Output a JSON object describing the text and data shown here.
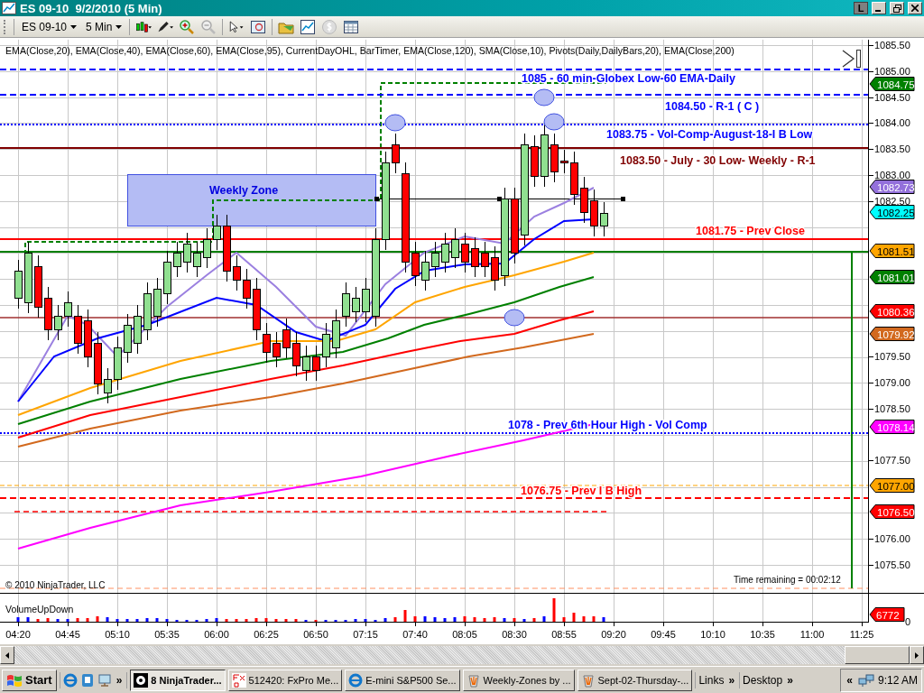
{
  "window": {
    "title": "ES 09-10  9/2/2010 (5 Min)",
    "buttons": [
      "L"
    ]
  },
  "toolbar": {
    "instrument": "ES 09-10",
    "interval": "5 Min"
  },
  "chart": {
    "indicators": "EMA(Close,20), EMA(Close,40), EMA(Close,60), EMA(Close,95), CurrentDayOHL, BarTimer, EMA(Close,120), SMA(Close,10), Pivots(Daily,DailyBars,20), EMA(Close,200)",
    "zone_label": "Weekly Zone",
    "levels": [
      {
        "text": "1085 - 60 min-Globex Low-60 EMA-Daily",
        "color": "#0000ff",
        "kind": "dashed"
      },
      {
        "text": "1084.50 - R-1 ( C )",
        "color": "#0000ff",
        "kind": "dashed"
      },
      {
        "text": "1083.75 - Vol-Comp-August-18-I B Low",
        "color": "#0000ff",
        "kind": "dotted"
      },
      {
        "text": "1083.50 - July - 30 Low- Weekly - R-1",
        "color": "#800000",
        "kind": "solid"
      },
      {
        "text": "1081.75 - Prev Close",
        "color": "#ff0000",
        "kind": "solid"
      },
      {
        "text": "1078 - Prev 6th Hour High - Vol Comp",
        "color": "#0000ff",
        "kind": "dotted"
      },
      {
        "text": "1076.75 - Prev I B High",
        "color": "#ff0000",
        "kind": "dashed"
      }
    ],
    "price_ticks": [
      "1085.50",
      "1085.00",
      "1084.50",
      "1084.00",
      "1083.50",
      "1083.00",
      "1082.50",
      "1079.50",
      "1079.00",
      "1078.50",
      "1077.50",
      "1076.00",
      "1075.50"
    ],
    "price_tags": [
      {
        "text": "1084.75",
        "color": "#008000"
      },
      {
        "text": "1082.73",
        "color": "#9370db"
      },
      {
        "text": "1082.25",
        "color": "#00ffff"
      },
      {
        "text": "1081.51",
        "color": "#ffa500"
      },
      {
        "text": "1081.01",
        "color": "#008000"
      },
      {
        "text": "1080.36",
        "color": "#ff0000"
      },
      {
        "text": "1079.92",
        "color": "#d2691e"
      },
      {
        "text": "1078.14",
        "color": "#ff00ff"
      },
      {
        "text": "1077.00",
        "color": "#ffa500"
      },
      {
        "text": "1076.50",
        "color": "#ff0000"
      }
    ],
    "copyright": "© 2010 NinjaTrader, LLC",
    "time_remaining": "Time remaining = 00:02:12"
  },
  "volume_panel": {
    "title": "VolumeUpDown",
    "tag": {
      "text": "6772",
      "color": "#ff0000"
    },
    "zero_label": "0"
  },
  "time_axis": [
    "04:20",
    "04:45",
    "05:10",
    "05:35",
    "06:00",
    "06:25",
    "06:50",
    "07:15",
    "07:40",
    "08:05",
    "08:30",
    "08:55",
    "09:20",
    "09:45",
    "10:10",
    "10:35",
    "11:00",
    "11:25"
  ],
  "taskbar": {
    "start": "Start",
    "quick_launch_more": "»",
    "tasks": [
      {
        "label": "8 NinjaTrader...",
        "selected": true
      },
      {
        "label": "512420: FxPro Me...",
        "selected": false
      },
      {
        "label": "E-mini S&P500 Se...",
        "selected": false
      },
      {
        "label": "Weekly-Zones by ...",
        "selected": false
      },
      {
        "label": "Sept-02-Thursday-...",
        "selected": false
      }
    ],
    "links": "Links",
    "links_more": "»",
    "desktop": "Desktop",
    "desktop_more": "»",
    "tray_expand": "«",
    "clock": "9:12 AM"
  }
}
